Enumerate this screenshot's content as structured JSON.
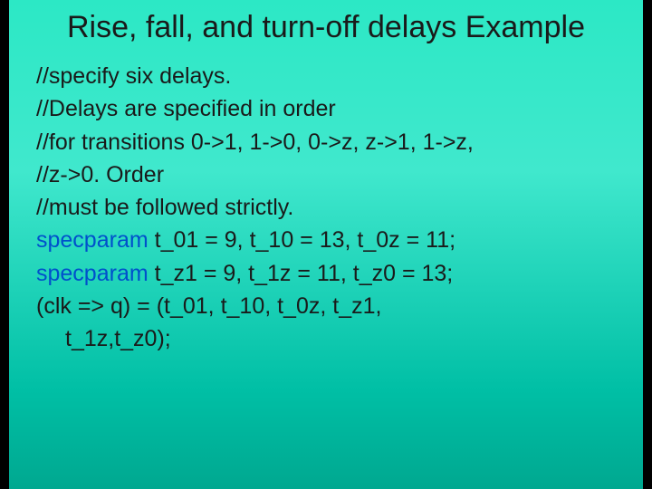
{
  "title": "Rise, fall, and turn-off delays Example",
  "lines": {
    "c1": "//specify six delays.",
    "c2": "//Delays are specified in order",
    "c3": "//for transitions 0->1, 1->0, 0->z, z->1, 1->z,",
    "c4": "//z->0. Order",
    "c5": "//must be followed strictly.",
    "kw1": "specparam ",
    "p1": "t_01 = 9, t_10 = 13, t_0z = 11;",
    "kw2": "specparam ",
    "p2": "t_z1 = 9, t_1z = 11, t_z0 = 13;",
    "expr1": "(clk => q) = (t_01, t_10, t_0z, t_z1,",
    "expr2": "t_1z,t_z0);"
  }
}
